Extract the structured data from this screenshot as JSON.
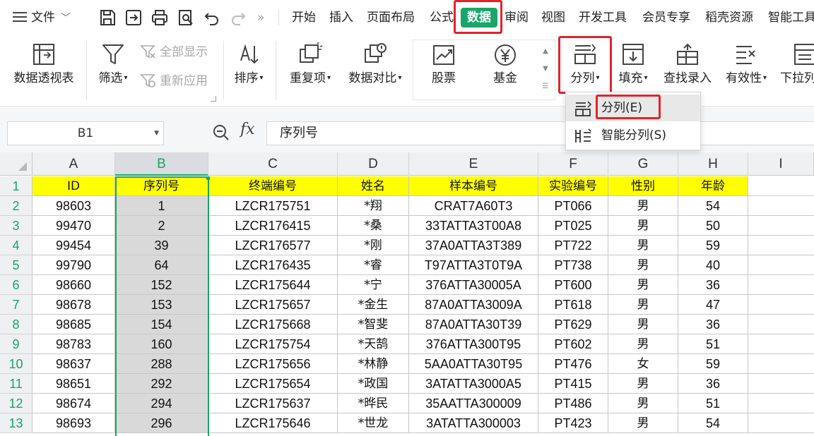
{
  "menu": {
    "file": "文件",
    "tabs": [
      "开始",
      "插入",
      "页面布局",
      "公式",
      "数据",
      "审阅",
      "视图",
      "开发工具",
      "会员专享",
      "稻壳资源",
      "智能工具"
    ],
    "active_tab": "数据",
    "more": "»"
  },
  "ribbon": {
    "pivot": "数据透视表",
    "filter": "筛选",
    "show_all": "全部显示",
    "reapply": "重新应用",
    "sort": "排序",
    "duplicates": "重复项",
    "compare": "数据对比",
    "stocks": "股票",
    "funds": "基金",
    "split": "分列",
    "fill": "填充",
    "lookup": "查找录入",
    "validity": "有效性",
    "dropdown_list": "下拉列"
  },
  "split_menu": {
    "items": [
      "分列(E)",
      "智能分列(S)"
    ]
  },
  "formula_bar": {
    "name_box": "B1",
    "fx": "fx",
    "content": "序列号"
  },
  "columns": [
    "A",
    "B",
    "C",
    "D",
    "E",
    "F",
    "G",
    "H",
    "I"
  ],
  "selected_column": "B",
  "rows": [
    1,
    2,
    3,
    4,
    5,
    6,
    7,
    8,
    9,
    10,
    11,
    12,
    13
  ],
  "table": {
    "headers": [
      "ID",
      "序列号",
      "终端编号",
      "姓名",
      "样本编号",
      "实验编号",
      "性别",
      "年龄"
    ],
    "data": [
      [
        "98603",
        "1",
        "LZCR175751",
        "*翔",
        "CRAT7A60T3",
        "PT066",
        "男",
        "54"
      ],
      [
        "99470",
        "2",
        "LZCR176415",
        "*桑",
        "33TATTA3T00A8",
        "PT025",
        "男",
        "50"
      ],
      [
        "99454",
        "39",
        "LZCR176577",
        "*刚",
        "37A0ATTA3T389",
        "PT722",
        "男",
        "59"
      ],
      [
        "99790",
        "64",
        "LZCR176435",
        "*睿",
        "T97ATTA3T0T9A",
        "PT738",
        "男",
        "40"
      ],
      [
        "98660",
        "152",
        "LZCR175644",
        "*宁",
        "376ATTA30005A",
        "PT600",
        "男",
        "36"
      ],
      [
        "98678",
        "153",
        "LZCR175657",
        "*金生",
        "87A0ATTA3009A",
        "PT618",
        "男",
        "47"
      ],
      [
        "98685",
        "154",
        "LZCR175668",
        "*智斐",
        "87A0ATTA30T39",
        "PT629",
        "男",
        "36"
      ],
      [
        "98783",
        "160",
        "LZCR175754",
        "*天鹄",
        "376ATTA300T95",
        "PT602",
        "男",
        "51"
      ],
      [
        "98637",
        "288",
        "LZCR175656",
        "*林静",
        "5AA0ATTA30T95",
        "PT476",
        "女",
        "59"
      ],
      [
        "98651",
        "292",
        "LZCR175654",
        "*政国",
        "3ATATTA3000A5",
        "PT415",
        "男",
        "36"
      ],
      [
        "98674",
        "294",
        "LZCR175637",
        "*晔民",
        "35AATTA300009",
        "PT486",
        "男",
        "51"
      ],
      [
        "98693",
        "296",
        "LZCR175646",
        "*世龙",
        "3ATATTA300003",
        "PT423",
        "男",
        "54"
      ]
    ]
  },
  "colors": {
    "accent": "#1aa56a",
    "highlight_red": "#e0242b",
    "header_fill": "#ffff00"
  }
}
